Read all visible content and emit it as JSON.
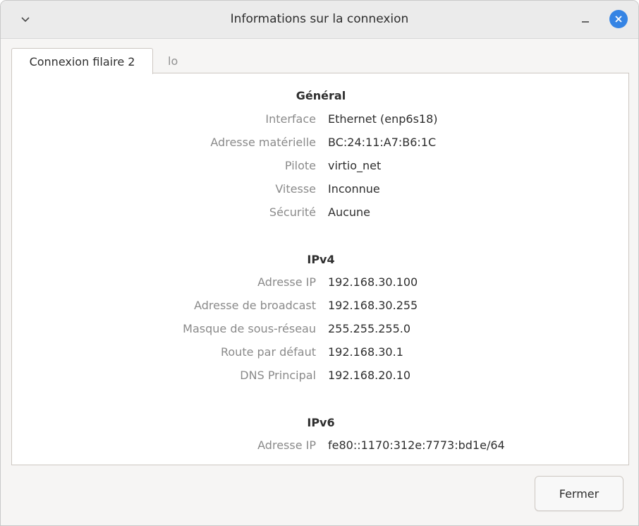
{
  "window": {
    "title": "Informations sur la connexion"
  },
  "tabs": [
    {
      "label": "Connexion filaire 2",
      "active": true
    },
    {
      "label": "lo",
      "active": false
    }
  ],
  "general": {
    "heading": "Général",
    "rows": [
      {
        "key": "Interface",
        "value": "Ethernet (enp6s18)"
      },
      {
        "key": "Adresse matérielle",
        "value": "BC:24:11:A7:B6:1C"
      },
      {
        "key": "Pilote",
        "value": "virtio_net"
      },
      {
        "key": "Vitesse",
        "value": "Inconnue"
      },
      {
        "key": "Sécurité",
        "value": "Aucune"
      }
    ]
  },
  "ipv4": {
    "heading": "IPv4",
    "rows": [
      {
        "key": "Adresse IP",
        "value": "192.168.30.100"
      },
      {
        "key": "Adresse de broadcast",
        "value": "192.168.30.255"
      },
      {
        "key": "Masque de sous-réseau",
        "value": "255.255.255.0"
      },
      {
        "key": "Route par défaut",
        "value": "192.168.30.1"
      },
      {
        "key": "DNS Principal",
        "value": "192.168.20.10"
      }
    ]
  },
  "ipv6": {
    "heading": "IPv6",
    "rows": [
      {
        "key": "Adresse IP",
        "value": "fe80::1170:312e:7773:bd1e/64"
      }
    ]
  },
  "footer": {
    "close_label": "Fermer"
  },
  "colors": {
    "accent": "#3584e4",
    "key_text": "#8a8a8a",
    "value_text": "#2e2e2e"
  },
  "icons": {
    "menu": "chevron-down-icon",
    "minimize": "minimize-icon",
    "close": "close-icon"
  }
}
